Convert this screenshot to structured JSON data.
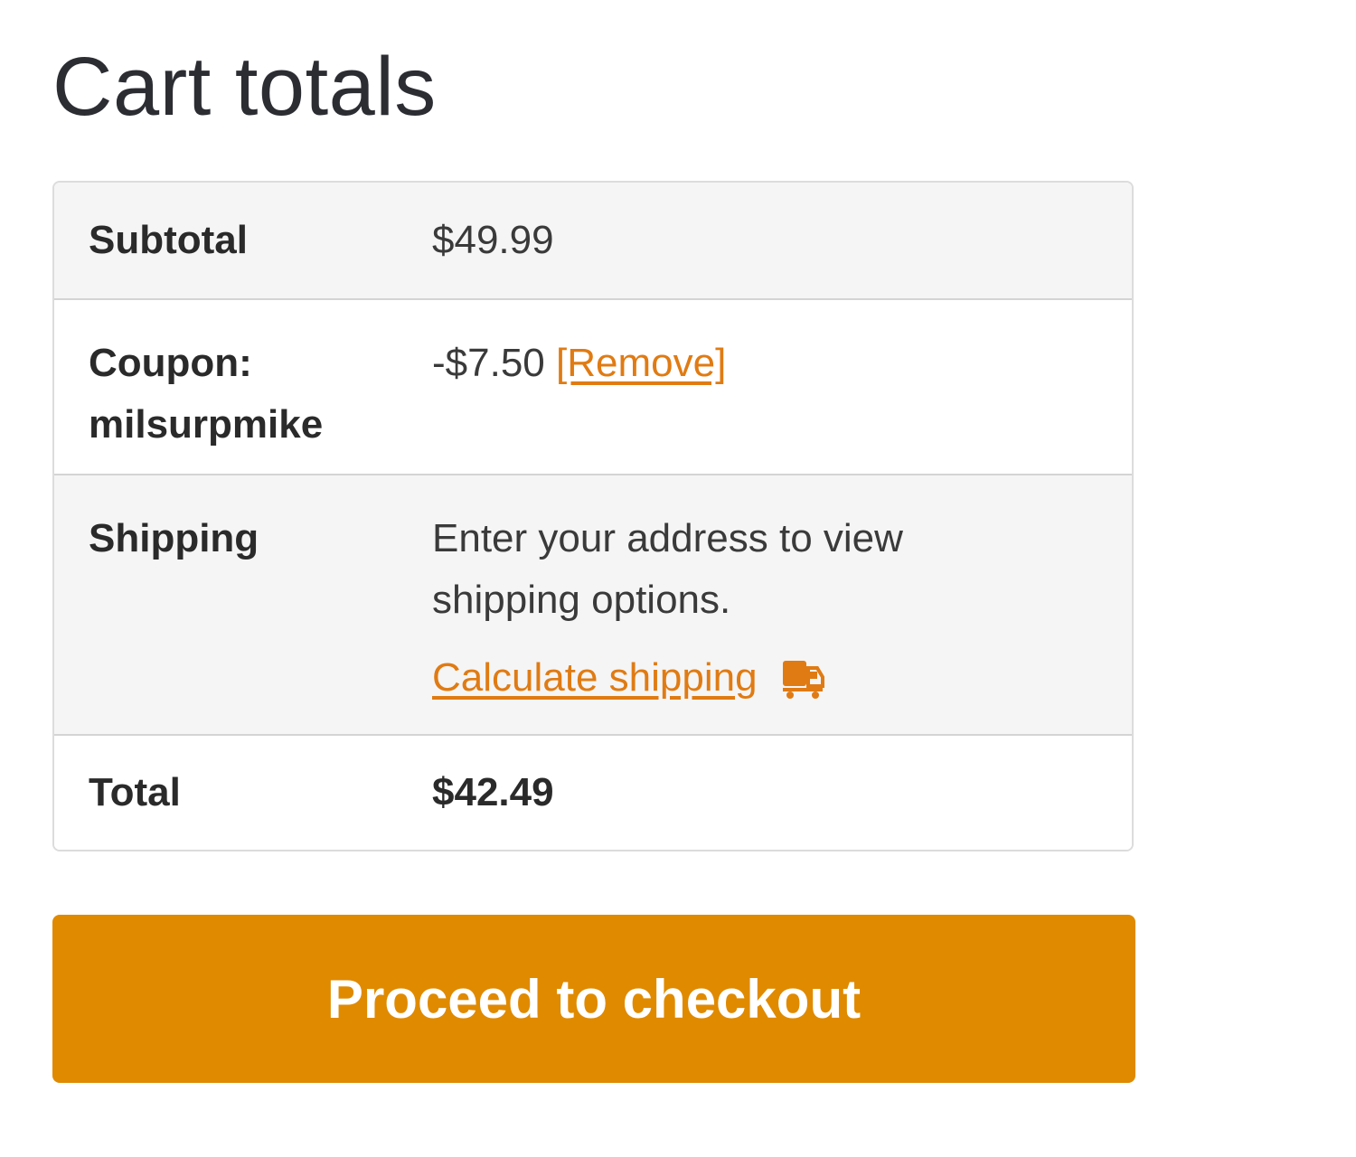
{
  "page": {
    "title": "Cart totals"
  },
  "totals": {
    "subtotal": {
      "label": "Subtotal",
      "value": "$49.99"
    },
    "coupon": {
      "label_line1": "Coupon:",
      "label_line2": "milsurpmike",
      "value": "-$7.50",
      "remove_link": "[Remove]"
    },
    "shipping": {
      "label": "Shipping",
      "message_line1": "Enter your address to view",
      "message_line2": "shipping options.",
      "calculate_link": "Calculate shipping",
      "icon": "truck-icon"
    },
    "total": {
      "label": "Total",
      "value": "$42.49"
    }
  },
  "checkout": {
    "button_label": "Proceed to checkout"
  },
  "colors": {
    "accent": "#e08a00",
    "link": "#e07b13",
    "row_shaded": "#f5f5f5",
    "text": "#2b2b2b"
  }
}
